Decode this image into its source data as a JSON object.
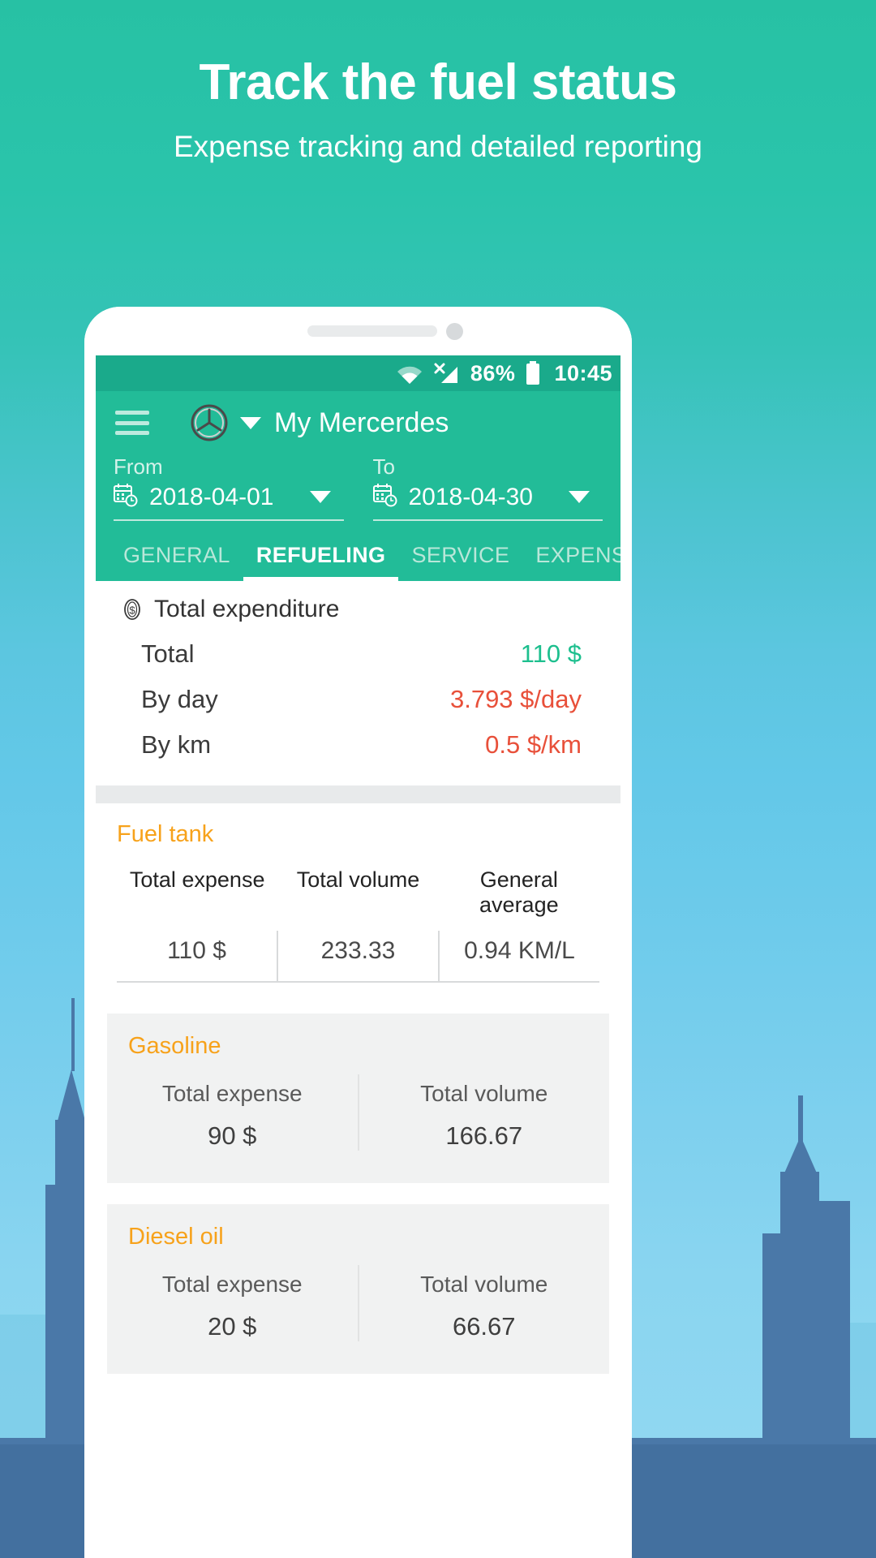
{
  "promo": {
    "title": "Track the fuel status",
    "subtitle": "Expense tracking and detailed reporting"
  },
  "colors": {
    "brand_green": "#22bc98",
    "status_bar_green": "#1aaa8b",
    "accent_orange": "#f7a21b",
    "value_green": "#1dbf8e",
    "value_red": "#e8503a",
    "card_gray": "#f1f2f2"
  },
  "status_bar": {
    "wifi": "wifi-icon",
    "signal": "cellular-signal-off-icon",
    "battery_percent": "86%",
    "battery": "battery-icon",
    "time": "10:45"
  },
  "app_bar": {
    "menu": "hamburger-menu-icon",
    "vehicle_logo": "mercedes-logo-icon",
    "vehicle_caret": "chevron-down-icon",
    "vehicle_name": "My Mercerdes"
  },
  "date_range": {
    "from": {
      "label": "From",
      "value": "2018-04-01",
      "icon": "calendar-clock-icon",
      "caret": "chevron-down-icon"
    },
    "to": {
      "label": "To",
      "value": "2018-04-30",
      "icon": "calendar-clock-icon",
      "caret": "chevron-down-icon"
    }
  },
  "tabs": [
    {
      "label": "GENERAL",
      "active": false
    },
    {
      "label": "REFUELING",
      "active": true
    },
    {
      "label": "SERVICE",
      "active": false
    },
    {
      "label": "EXPENSE",
      "active": false
    }
  ],
  "total_expenditure": {
    "icon": "dollar-coin-icon",
    "title": "Total expenditure",
    "rows": [
      {
        "key": "Total",
        "value": "110 $",
        "tone": "green"
      },
      {
        "key": "By day",
        "value": "3.793 $/day",
        "tone": "red"
      },
      {
        "key": "By km",
        "value": "0.5 $/km",
        "tone": "red"
      }
    ]
  },
  "fuel_tank": {
    "title": "Fuel tank",
    "headers": [
      "Total expense",
      "Total volume",
      "General average"
    ],
    "values": [
      "110 $",
      "233.33",
      "0.94 KM/L"
    ]
  },
  "fuel_types": [
    {
      "title": "Gasoline",
      "columns": [
        {
          "label": "Total expense",
          "value": "90 $"
        },
        {
          "label": "Total volume",
          "value": "166.67"
        }
      ]
    },
    {
      "title": "Diesel oil",
      "columns": [
        {
          "label": "Total expense",
          "value": "20 $"
        },
        {
          "label": "Total volume",
          "value": "66.67"
        }
      ]
    }
  ]
}
